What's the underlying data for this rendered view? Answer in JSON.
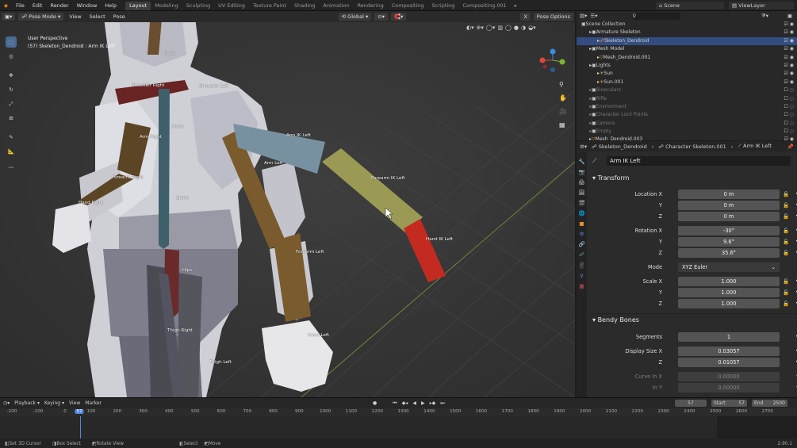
{
  "menus": [
    "File",
    "Edit",
    "Render",
    "Window",
    "Help"
  ],
  "workspaces": [
    "Layout",
    "Modeling",
    "Sculpting",
    "UV Editing",
    "Texture Paint",
    "Shading",
    "Animation",
    "Rendering",
    "Compositing",
    "Scripting",
    "Compositing.001"
  ],
  "active_workspace": "Layout",
  "scene": {
    "label": "Scene",
    "viewlayer": "ViewLayer"
  },
  "viewport": {
    "mode": "Pose Mode",
    "menus": [
      "View",
      "Select",
      "Pose"
    ],
    "orientation": "Global",
    "pose_options": "Pose Options",
    "overlay_line1": "User Perspective",
    "overlay_line2": "(57) Skeleton_Dendroid : Arm IK Left",
    "bones": {
      "neck": "Neck",
      "shoulder_right": "Shoulder Right",
      "shoulder_left": "Shoulder Left",
      "chest": "Chest",
      "arm_right": "Arm Right",
      "arm_left": "Arm Left",
      "arm_ik_left": "Arm IK Left",
      "forearm_ik_left": "Forearm IK Left",
      "hand_ik_left": "Hand IK Left",
      "forearm_right": "Forearm Right",
      "hand_right": "Hand Right",
      "spine": "Spine",
      "forearm_left": "Forearm Left",
      "hips": "Hips",
      "thigh_right": "Thigh Right",
      "hand_left": "Hand Left",
      "thigh_left": "Thigh Left"
    }
  },
  "outliner": {
    "rows": [
      {
        "label": "Scene Collection",
        "indent": 0,
        "dim": false
      },
      {
        "label": "Armature Skeleton",
        "indent": 1,
        "dim": false
      },
      {
        "label": "Skeleton_Dendroid",
        "indent": 2,
        "dim": false,
        "selected": true
      },
      {
        "label": "Mesh Model",
        "indent": 1,
        "dim": false
      },
      {
        "label": "Mesh_Dendroid.001",
        "indent": 2,
        "dim": false
      },
      {
        "label": "Lights",
        "indent": 1,
        "dim": false
      },
      {
        "label": "Sun",
        "indent": 2,
        "dim": false
      },
      {
        "label": "Sun.001",
        "indent": 2,
        "dim": false
      },
      {
        "label": "Binoculars",
        "indent": 1,
        "dim": true
      },
      {
        "label": "Rifle",
        "indent": 1,
        "dim": true
      },
      {
        "label": "Environment",
        "indent": 1,
        "dim": true
      },
      {
        "label": "Character Lock Points",
        "indent": 1,
        "dim": true
      },
      {
        "label": "Camera",
        "indent": 1,
        "dim": true
      },
      {
        "label": "Empty",
        "indent": 1,
        "dim": true
      },
      {
        "label": "Mesh_Dendroid.003",
        "indent": 1,
        "dim": false
      }
    ]
  },
  "properties": {
    "breadcrumb": [
      "Skeleton_Dendroid",
      "Character Skeleton.001",
      "Arm IK Left"
    ],
    "bone_name": "Arm IK Left",
    "transform": {
      "title": "Transform",
      "location": [
        {
          "label": "Location X",
          "value": "0 m"
        },
        {
          "label": "Y",
          "value": "0 m"
        },
        {
          "label": "Z",
          "value": "0 m"
        }
      ],
      "rotation": [
        {
          "label": "Rotation X",
          "value": "-30°"
        },
        {
          "label": "Y",
          "value": "9.6°"
        },
        {
          "label": "Z",
          "value": "35.6°"
        }
      ],
      "mode_label": "Mode",
      "mode_value": "XYZ Euler",
      "scale": [
        {
          "label": "Scale X",
          "value": "1.000"
        },
        {
          "label": "Y",
          "value": "1.000"
        },
        {
          "label": "Z",
          "value": "1.000"
        }
      ]
    },
    "bendy": {
      "title": "Bendy Bones",
      "segments_label": "Segments",
      "segments_value": "1",
      "display_size": [
        {
          "label": "Display Size X",
          "value": "0.03057"
        },
        {
          "label": "Z",
          "value": "0.01057"
        }
      ],
      "curve_in": [
        {
          "label": "Curve In X",
          "value": "0.00000"
        },
        {
          "label": "In Y",
          "value": "0.00000"
        }
      ]
    }
  },
  "timeline": {
    "menus": [
      "Playback",
      "Keying",
      "View",
      "Marker"
    ],
    "current_frame": "57",
    "start_label": "Start",
    "start": "57",
    "end_label": "End",
    "end": "2500",
    "ticks": [
      "-200",
      "-100",
      "0",
      "57",
      "100",
      "200",
      "300",
      "400",
      "500",
      "600",
      "700",
      "800",
      "900",
      "1000",
      "1100",
      "1200",
      "1300",
      "1400",
      "1500",
      "1600",
      "1700",
      "1800",
      "1900",
      "2000",
      "2100",
      "2200",
      "2300",
      "2400",
      "2500",
      "2600",
      "2700"
    ]
  },
  "status": {
    "items": [
      "Set 3D Cursor",
      "Box Select",
      "Rotate View",
      "Select",
      "Move"
    ],
    "version": "2.90.1"
  }
}
